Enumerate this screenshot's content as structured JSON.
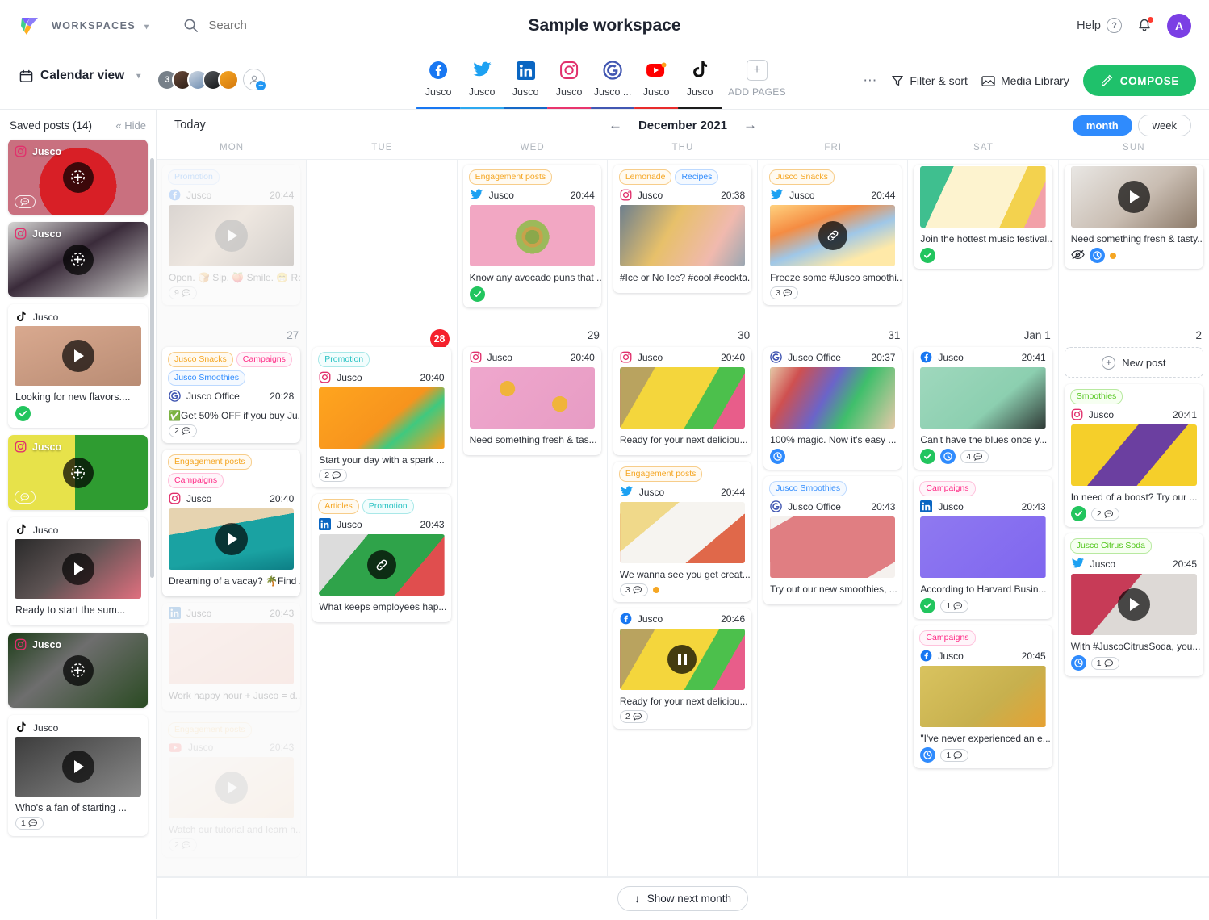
{
  "app": {
    "workspaces_label": "WORKSPACES",
    "title": "Sample workspace",
    "help_label": "Help",
    "avatar_initial": "A"
  },
  "search": {
    "placeholder": "Search"
  },
  "toolbar": {
    "calendar_view_label": "Calendar view",
    "avatar_count": "3",
    "more_label": "⋯",
    "filter_label": "Filter & sort",
    "media_library_label": "Media Library",
    "compose_label": "COMPOSE"
  },
  "pages": [
    {
      "label": "Jusco",
      "icon": "facebook-icon",
      "color": "#1877f2"
    },
    {
      "label": "Jusco",
      "icon": "twitter-icon",
      "color": "#1da1f2"
    },
    {
      "label": "Jusco",
      "icon": "linkedin-icon",
      "color": "#0a66c2"
    },
    {
      "label": "Jusco",
      "icon": "instagram-icon",
      "color": "#e1306c"
    },
    {
      "label": "Jusco ...",
      "icon": "google-icon",
      "color": "#4257b2"
    },
    {
      "label": "Jusco",
      "icon": "youtube-icon",
      "color": "#ff0000"
    },
    {
      "label": "Jusco",
      "icon": "tiktok-icon",
      "color": "#1c1c1c"
    },
    {
      "label": "ADD PAGES",
      "icon": "plus-icon",
      "color": ""
    }
  ],
  "sidebar": {
    "title": "Saved posts (14)",
    "hide_label": "« Hide",
    "posts": [
      {
        "network": "instagram-icon",
        "name": "Jusco",
        "caption": "",
        "overlay": true,
        "kind": "add",
        "comments": "",
        "has_comment_pill": true,
        "approved": false
      },
      {
        "network": "instagram-icon",
        "name": "Jusco",
        "caption": "",
        "overlay": true,
        "kind": "add",
        "comments": "",
        "has_comment_pill": false,
        "approved": false
      },
      {
        "network": "tiktok-icon",
        "name": "Jusco",
        "caption": "Looking for new flavors....",
        "overlay": false,
        "kind": "play",
        "comments": "",
        "has_comment_pill": false,
        "approved": true
      },
      {
        "network": "instagram-icon",
        "name": "Jusco",
        "caption": "",
        "overlay": true,
        "kind": "add",
        "comments": "",
        "has_comment_pill": true,
        "approved": false
      },
      {
        "network": "tiktok-icon",
        "name": "Jusco",
        "caption": "Ready to start the sum...",
        "overlay": false,
        "kind": "play",
        "comments": "",
        "has_comment_pill": false,
        "approved": false
      },
      {
        "network": "instagram-icon",
        "name": "Jusco",
        "caption": "",
        "overlay": true,
        "kind": "add",
        "comments": "",
        "has_comment_pill": false,
        "approved": false
      },
      {
        "network": "tiktok-icon",
        "name": "Jusco",
        "caption": "Who's a fan of starting ...",
        "overlay": false,
        "kind": "play",
        "comments": "1",
        "has_comment_pill": true,
        "approved": false
      }
    ]
  },
  "calendar": {
    "today_label": "Today",
    "month_label": "December 2021",
    "prev_arrow": "←",
    "next_arrow": "→",
    "view_month": "month",
    "view_week": "week",
    "day_headers": [
      "MON",
      "TUE",
      "WED",
      "THU",
      "FRI",
      "SAT",
      "SUN"
    ],
    "new_post_label": "New post",
    "show_next_month_label": "Show next month",
    "week1": [
      {
        "daynum": "",
        "out": true,
        "posts": [
          {
            "tags": [
              {
                "text": "Promotion",
                "cls": "t-blue"
              }
            ],
            "network": "facebook-icon",
            "name": "Jusco",
            "time": "20:44",
            "media": "coffee",
            "overlay": "play",
            "caption": "Open. 🍞 Sip. 🍑 Smile. 😁 Rep...",
            "comments": "9",
            "badges": [],
            "fade": "faded"
          }
        ]
      },
      {
        "daynum": "",
        "out": false,
        "posts": []
      },
      {
        "daynum": "",
        "out": false,
        "posts": [
          {
            "tags": [
              {
                "text": "Engagement posts",
                "cls": "t-orange"
              }
            ],
            "network": "twitter-icon",
            "name": "Jusco",
            "time": "20:44",
            "media": "avocado",
            "overlay": "",
            "caption": "Know any avocado puns that ...",
            "comments": "",
            "badges": [
              "approved"
            ],
            "fade": ""
          }
        ]
      },
      {
        "daynum": "",
        "out": false,
        "posts": [
          {
            "tags": [
              {
                "text": "Lemonade",
                "cls": "t-orange"
              },
              {
                "text": "Recipes",
                "cls": "t-blue"
              }
            ],
            "network": "instagram-icon",
            "name": "Jusco",
            "time": "20:38",
            "media": "cocktails",
            "overlay": "",
            "caption": "#Ice or No Ice? #cool #cockta...",
            "comments": "",
            "badges": [],
            "fade": ""
          }
        ]
      },
      {
        "daynum": "",
        "out": false,
        "posts": [
          {
            "tags": [
              {
                "text": "Jusco Snacks",
                "cls": "t-orange"
              }
            ],
            "network": "twitter-icon",
            "name": "Jusco",
            "time": "20:44",
            "media": "popsicles",
            "overlay": "link",
            "caption": "Freeze some #Jusco smoothi...",
            "comments": "3",
            "badges": [],
            "fade": ""
          }
        ]
      },
      {
        "daynum": "",
        "out": false,
        "posts": [
          {
            "tags": [],
            "network": "",
            "name": "",
            "time": "",
            "media": "mojito",
            "overlay": "",
            "caption": "Join the hottest music festival...",
            "comments": "",
            "badges": [
              "approved"
            ],
            "fade": ""
          }
        ]
      },
      {
        "daynum": "",
        "out": false,
        "posts": [
          {
            "tags": [],
            "network": "",
            "name": "",
            "time": "",
            "media": "kitchen",
            "overlay": "play",
            "caption": "Need something fresh & tasty...",
            "comments": "",
            "badges": [
              "hidden",
              "clock",
              "dot"
            ],
            "fade": ""
          }
        ]
      }
    ],
    "week2": [
      {
        "daynum": "27",
        "out": true,
        "today": false,
        "posts": [
          {
            "tags": [
              {
                "text": "Jusco Snacks",
                "cls": "t-orange"
              },
              {
                "text": "Campaigns",
                "cls": "t-pink"
              },
              {
                "text": "Jusco Smoothies",
                "cls": "t-blue"
              }
            ],
            "network": "google-icon",
            "name": "Jusco Office",
            "time": "20:28",
            "media": "",
            "overlay": "",
            "caption": "✅Get 50% OFF if you buy Ju...",
            "comments": "2",
            "badges": [],
            "fade": ""
          },
          {
            "tags": [
              {
                "text": "Engagement posts",
                "cls": "t-orange"
              },
              {
                "text": "Campaigns",
                "cls": "t-pink"
              }
            ],
            "network": "instagram-icon",
            "name": "Jusco",
            "time": "20:40",
            "media": "beach",
            "overlay": "play",
            "caption": "Dreaming of a vacay? 🌴Find ...",
            "comments": "",
            "badges": [],
            "fade": ""
          },
          {
            "tags": [],
            "network": "linkedin-icon",
            "name": "Jusco",
            "time": "20:43",
            "media": "hands",
            "overlay": "",
            "caption": "Work happy hour + Jusco = d...",
            "comments": "",
            "badges": [],
            "fade": "faded"
          },
          {
            "tags": [
              {
                "text": "Engagement posts",
                "cls": "t-orange"
              }
            ],
            "network": "youtube-icon",
            "name": "Jusco",
            "time": "20:43",
            "media": "oranges",
            "overlay": "play",
            "caption": "Watch our tutorial and learn h...",
            "comments": "2",
            "badges": [],
            "fade": "faded2"
          }
        ]
      },
      {
        "daynum": "28",
        "out": false,
        "today": true,
        "posts": [
          {
            "tags": [
              {
                "text": "Promotion",
                "cls": "t-teal"
              }
            ],
            "network": "instagram-icon",
            "name": "Jusco",
            "time": "20:40",
            "media": "orangebottle",
            "overlay": "",
            "caption": "Start your day with a spark ...",
            "comments": "2",
            "badges": [],
            "fade": ""
          },
          {
            "tags": [
              {
                "text": "Articles",
                "cls": "t-orange"
              },
              {
                "text": "Promotion",
                "cls": "t-teal"
              }
            ],
            "network": "linkedin-icon",
            "name": "Jusco",
            "time": "20:43",
            "media": "laptop",
            "overlay": "link",
            "caption": "What keeps employees hap...",
            "comments": "",
            "badges": [],
            "fade": ""
          }
        ]
      },
      {
        "daynum": "29",
        "out": false,
        "today": false,
        "posts": [
          {
            "tags": [],
            "network": "instagram-icon",
            "name": "Jusco",
            "time": "20:40",
            "media": "lemonpink",
            "overlay": "",
            "caption": "Need something fresh & tas...",
            "comments": "",
            "badges": [],
            "fade": ""
          }
        ]
      },
      {
        "daynum": "30",
        "out": false,
        "today": false,
        "posts": [
          {
            "tags": [],
            "network": "instagram-icon",
            "name": "Jusco",
            "time": "20:40",
            "media": "tropical",
            "overlay": "",
            "caption": "Ready for your next deliciou...",
            "comments": "",
            "badges": [],
            "fade": ""
          },
          {
            "tags": [
              {
                "text": "Engagement posts",
                "cls": "t-orange"
              }
            ],
            "network": "twitter-icon",
            "name": "Jusco",
            "time": "20:44",
            "media": "fruitflat",
            "overlay": "",
            "caption": "We wanna see you get creat...",
            "comments": "3",
            "badges": [
              "dot"
            ],
            "fade": ""
          },
          {
            "tags": [],
            "network": "facebook-icon",
            "name": "Jusco",
            "time": "20:46",
            "media": "tropical2",
            "overlay": "pause",
            "caption": "Ready for your next deliciou...",
            "comments": "2",
            "badges": [],
            "fade": ""
          }
        ]
      },
      {
        "daynum": "31",
        "out": false,
        "today": false,
        "posts": [
          {
            "tags": [],
            "network": "google-icon",
            "name": "Jusco Office",
            "time": "20:37",
            "media": "bottles",
            "overlay": "",
            "caption": "100% magic. Now it's easy ...",
            "comments": "",
            "badges": [
              "clock"
            ],
            "fade": ""
          },
          {
            "tags": [
              {
                "text": "Jusco Smoothies",
                "cls": "t-blue"
              }
            ],
            "network": "google-icon",
            "name": "Jusco Office",
            "time": "20:43",
            "media": "sixpack",
            "overlay": "",
            "caption": "Try out our new smoothies, ...",
            "comments": "",
            "badges": [],
            "fade": ""
          }
        ]
      },
      {
        "daynum": "Jan 1",
        "out": false,
        "today": false,
        "posts": [
          {
            "tags": [],
            "network": "facebook-icon",
            "name": "Jusco",
            "time": "20:41",
            "media": "hose",
            "overlay": "",
            "caption": "Can't have the blues once y...",
            "comments": "4",
            "badges": [
              "approved",
              "clock"
            ],
            "fade": ""
          },
          {
            "tags": [
              {
                "text": "Campaigns",
                "cls": "t-pink"
              }
            ],
            "network": "linkedin-icon",
            "name": "Jusco",
            "time": "20:43",
            "media": "pencils",
            "overlay": "",
            "caption": "According to Harvard Busin...",
            "comments": "1",
            "badges": [
              "approved"
            ],
            "fade": ""
          },
          {
            "tags": [
              {
                "text": "Campaigns",
                "cls": "t-pink"
              }
            ],
            "network": "facebook-icon",
            "name": "Jusco",
            "time": "20:45",
            "media": "mango",
            "overlay": "",
            "caption": "\"I've never experienced an e...",
            "comments": "1",
            "badges": [
              "clock"
            ],
            "fade": ""
          }
        ]
      },
      {
        "daynum": "2",
        "out": false,
        "today": false,
        "newpost": true,
        "posts": [
          {
            "tags": [
              {
                "text": "Smoothies",
                "cls": "t-green"
              }
            ],
            "network": "instagram-icon",
            "name": "Jusco",
            "time": "20:41",
            "media": "purplecan",
            "overlay": "",
            "caption": "In need of a boost? Try our ...",
            "comments": "2",
            "badges": [
              "approved"
            ],
            "fade": ""
          },
          {
            "tags": [
              {
                "text": "Jusco Citrus Soda",
                "cls": "t-green"
              }
            ],
            "network": "twitter-icon",
            "name": "Jusco",
            "time": "20:45",
            "media": "pomegranate",
            "overlay": "play",
            "caption": "With #JuscoCitrusSoda, you...",
            "comments": "1",
            "badges": [
              "clock"
            ],
            "fade": ""
          }
        ]
      }
    ]
  }
}
